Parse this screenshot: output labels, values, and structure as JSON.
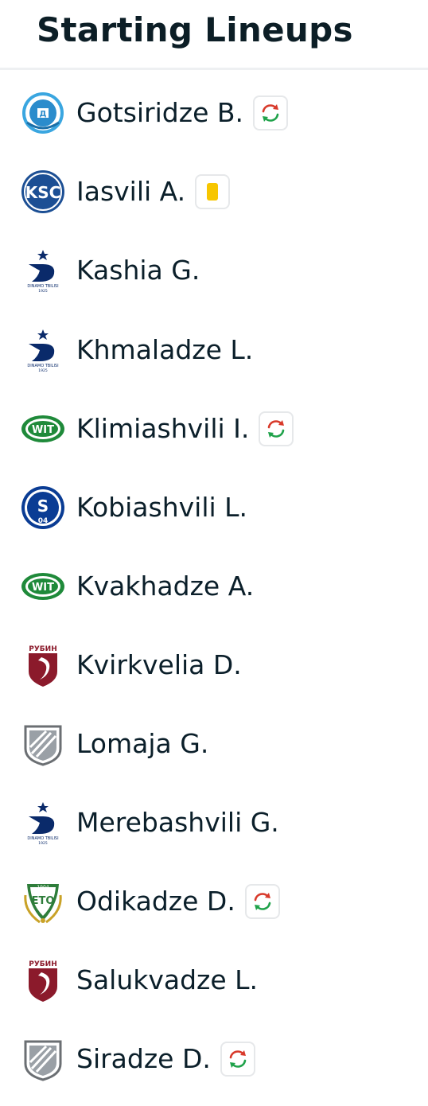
{
  "header": {
    "title": "Starting Lineups"
  },
  "players": [
    {
      "name": "Gotsiridze B.",
      "team_logo": "dnipro-logo",
      "event": "substitution"
    },
    {
      "name": "Iasvili A.",
      "team_logo": "ksc-logo",
      "event": "yellow-card"
    },
    {
      "name": "Kashia G.",
      "team_logo": "dinamo-tbilisi-logo",
      "event": ""
    },
    {
      "name": "Khmaladze L.",
      "team_logo": "dinamo-tbilisi-logo",
      "event": ""
    },
    {
      "name": "Klimiashvili I.",
      "team_logo": "wit-georgia-logo",
      "event": "substitution"
    },
    {
      "name": "Kobiashvili L.",
      "team_logo": "schalke-logo",
      "event": ""
    },
    {
      "name": "Kvakhadze A.",
      "team_logo": "wit-georgia-logo",
      "event": ""
    },
    {
      "name": "Kvirkvelia D.",
      "team_logo": "rubin-kazan-logo",
      "event": ""
    },
    {
      "name": "Lomaja G.",
      "team_logo": "generic-shield-logo",
      "event": ""
    },
    {
      "name": "Merebashvili G.",
      "team_logo": "dinamo-tbilisi-logo",
      "event": ""
    },
    {
      "name": "Odikadze D.",
      "team_logo": "eto-gyor-logo",
      "event": "substitution"
    },
    {
      "name": "Salukvadze L.",
      "team_logo": "rubin-kazan-logo",
      "event": ""
    },
    {
      "name": "Siradze D.",
      "team_logo": "generic-shield-logo",
      "event": "substitution"
    }
  ],
  "colors": {
    "sub_out": "#d83a2b",
    "sub_in": "#1fa24a",
    "yellow_card": "#f7c600",
    "text": "#0b1f2a"
  }
}
